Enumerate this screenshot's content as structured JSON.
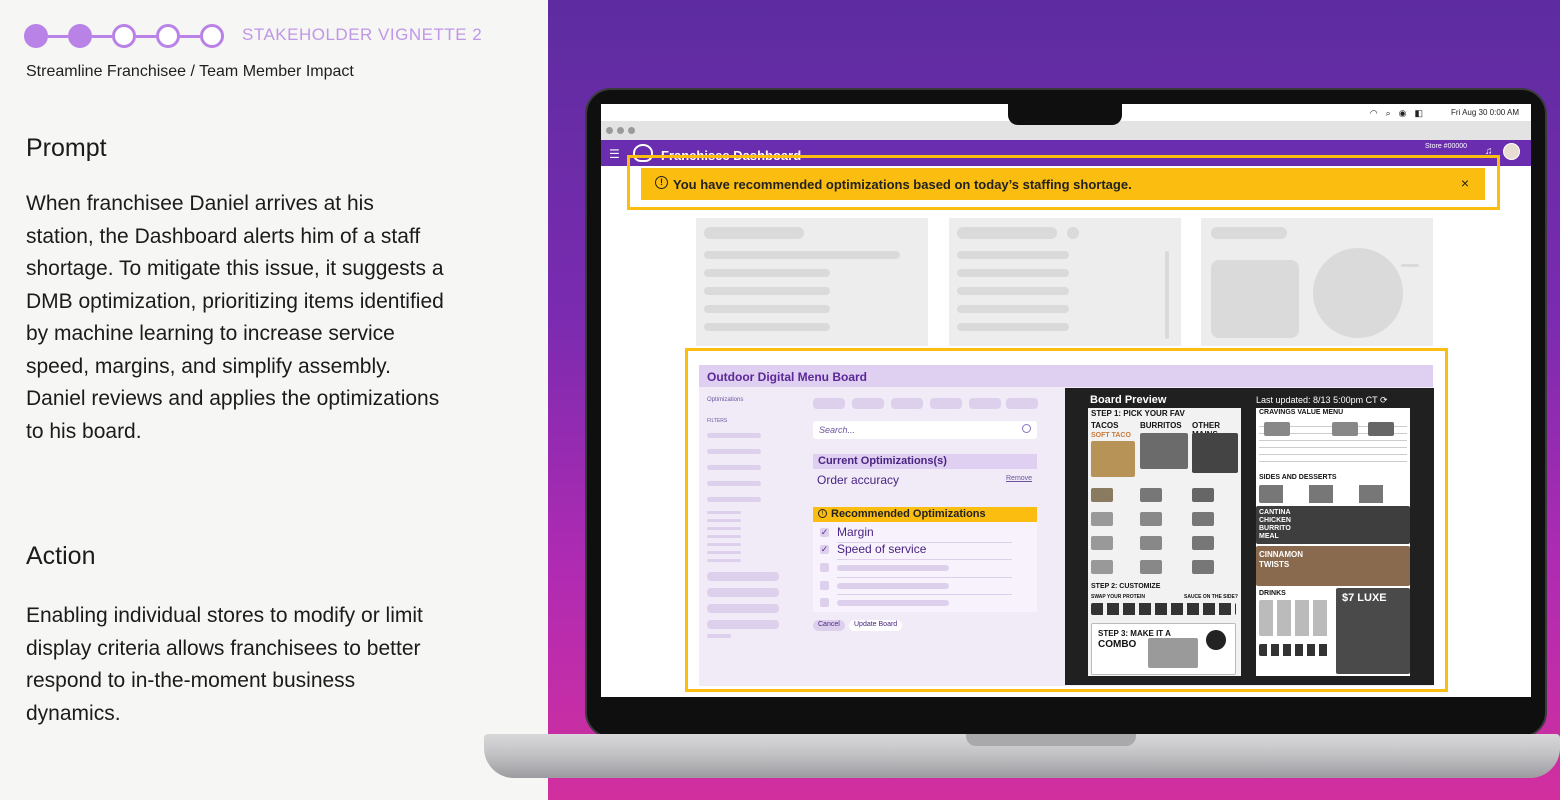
{
  "header": {
    "vignette_label": "STAKEHOLDER VIGNETTE 2",
    "subtitle": "Streamline Franchisee / Team Member Impact",
    "steps_total": 5,
    "steps_completed": 2
  },
  "prompt": {
    "heading": "Prompt",
    "body": "When franchisee Daniel arrives at his station, the Dashboard alerts him of a staff shortage. To mitigate this issue, it suggests a DMB optimization, prioritizing items identified by machine learning to increase service speed, margins, and simplify assembly. Daniel reviews and applies the optimizations to his board."
  },
  "action": {
    "heading": "Action",
    "body": "Enabling individual stores to modify or limit display criteria allows franchisees to better respond to in-the-moment business dynamics."
  },
  "colors": {
    "accent_purple": "#6a2db0",
    "alert_yellow": "#fbbd0f",
    "step_lilac": "#b982e6"
  },
  "os_menubar": {
    "datetime": "Fri Aug 30  0:00 AM",
    "icons": [
      "wifi-icon",
      "search-icon",
      "user-icon",
      "control-center-icon"
    ]
  },
  "app": {
    "title": "Franchisee Dashboard",
    "store": "Store #00000",
    "alert_text": "You have recommended optimizations based on today’s staffing shortage.",
    "alert_close": "×"
  },
  "dmb": {
    "title": "Outdoor Digital Menu Board",
    "sidebar_link": "Optimizations",
    "filters_label": "FILTERS",
    "search_placeholder": "Search...",
    "current_heading": "Current Optimizations(s)",
    "current_item": "Order accuracy",
    "remove_label": "Remove",
    "recommended_heading": "Recommended Optimizations",
    "recommended_items": [
      {
        "label": "Margin",
        "checked": true
      },
      {
        "label": "Speed of service",
        "checked": true
      }
    ],
    "cancel_label": "Cancel",
    "update_label": "Update Board"
  },
  "preview": {
    "title": "Board Preview",
    "last_updated": "Last updated: 8/13 5:00pm CT",
    "left_board": {
      "step1": "STEP 1: PICK YOUR FAV",
      "cols": [
        "TACOS",
        "BURRITOS",
        "OTHER MAINS"
      ],
      "soft_taco": "SOFT TACO",
      "step2": "STEP 2: CUSTOMIZE",
      "swap": "SWAP YOUR PROTEIN",
      "sauce": "SAUCE ON THE SIDE?",
      "step3": "STEP 3: MAKE IT A",
      "combo": "COMBO"
    },
    "right_board": {
      "cravings": "CRAVINGS VALUE MENU",
      "sides": "SIDES AND DESSERTS",
      "burrito_meal": "CANTINA CHICKEN BURRITO MEAL",
      "twists": "CINNAMON TWISTS",
      "drinks": "DRINKS",
      "luxe": "$7 LUXE"
    }
  }
}
